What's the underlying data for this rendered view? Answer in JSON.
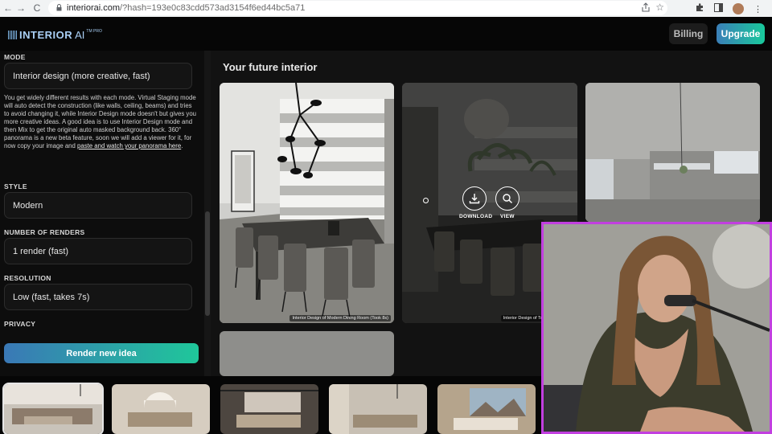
{
  "browser": {
    "back_label": "←",
    "forward_label": "→",
    "reload_label": "C",
    "url_host": "interiorai.com",
    "url_path": "/?hash=193e0c83cdd573ad3154f6ed44bc5a71",
    "icons": [
      "share-icon",
      "star-icon",
      "extensions-icon",
      "sidebar-icon",
      "profile-avatar"
    ]
  },
  "header": {
    "logo_text": "INTERIOR",
    "logo_ai": "AI",
    "logo_pro": "TM PRO",
    "billing_label": "Billing",
    "upgrade_label": "Upgrade"
  },
  "sidebar": {
    "mode": {
      "label": "MODE",
      "value": "Interior design (more creative, fast)",
      "description": "You get widely different results with each mode. Virtual Staging mode will auto detect the construction (like walls, ceiling, beams) and tries to avoid changing it, while Interior Design mode doesn't but gives you more creative ideas. A good idea is to use Interior Design mode and then Mix to get the original auto masked background back. 360° panorama is a new beta feature, soon we will add a viewer for it, for now copy your image and ",
      "link_text": "paste and watch your panorama here",
      "link_suffix": "."
    },
    "style": {
      "label": "STYLE",
      "value": "Modern"
    },
    "renders": {
      "label": "NUMBER OF RENDERS",
      "value": "1 render (fast)"
    },
    "resolution": {
      "label": "RESOLUTION",
      "value": "Low (fast, takes 7s)"
    },
    "privacy": {
      "label": "PRIVACY"
    },
    "render_button_label": "Render new idea"
  },
  "main": {
    "title": "Your future interior",
    "cards": [
      {
        "caption": "Interior Design of Modern Dining Room (Took 8s)"
      },
      {
        "caption": "Interior Design of Tropical Dining R",
        "download_label": "DOWNLOAD",
        "view_label": "VIEW"
      },
      {
        "caption": ""
      },
      {
        "caption": ""
      }
    ]
  },
  "colors": {
    "accent_start": "#3a78b6",
    "accent_end": "#1fc79a",
    "webcam_border": "#c23fe0",
    "background": "#0b0b0b"
  }
}
